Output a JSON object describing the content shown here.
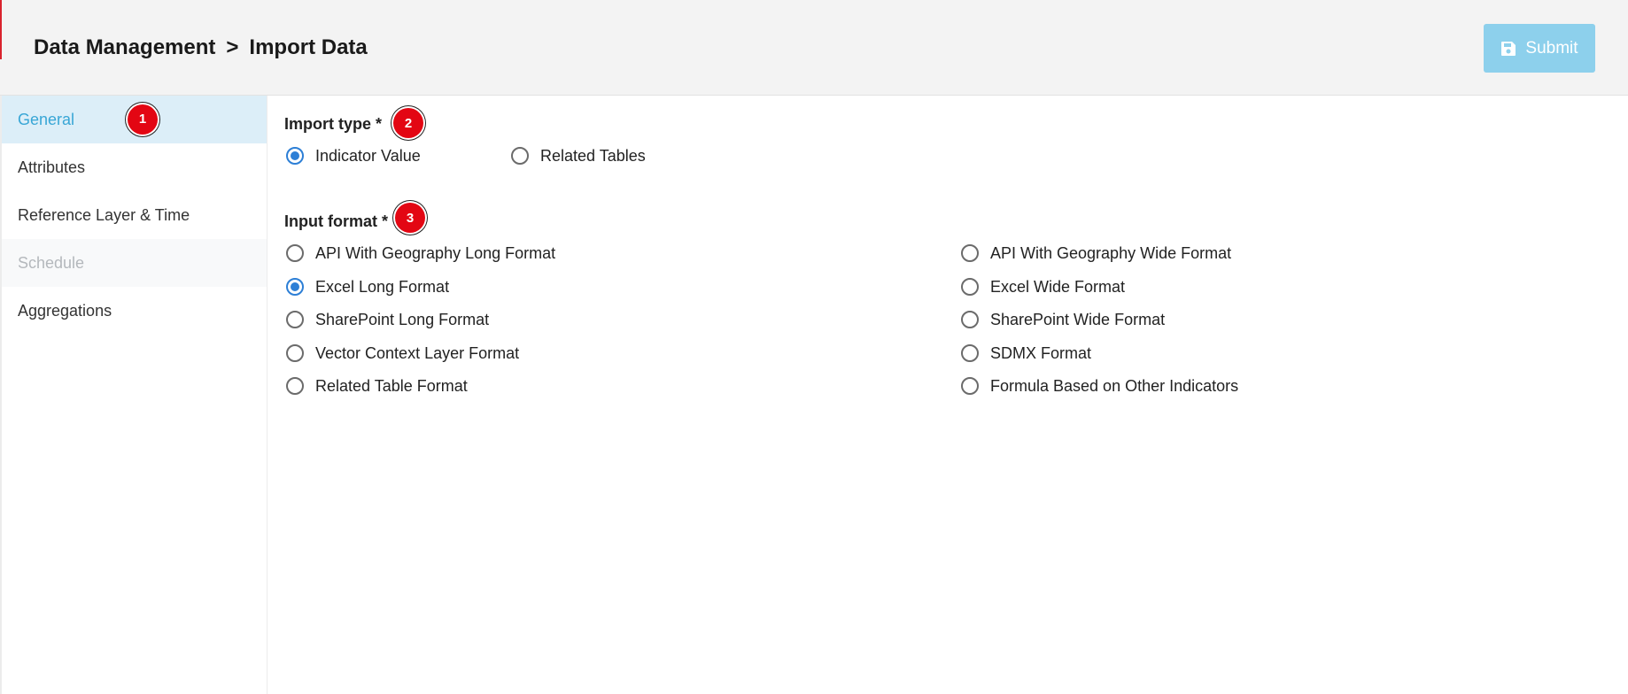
{
  "header": {
    "breadcrumb_parent": "Data Management",
    "breadcrumb_separator": ">",
    "breadcrumb_current": "Import Data",
    "submit_label": "Submit",
    "submit_icon": "save-icon",
    "submit_color": "#8dd0ec"
  },
  "sidebar": {
    "items": [
      {
        "label": "General",
        "state": "active"
      },
      {
        "label": "Attributes",
        "state": "normal"
      },
      {
        "label": "Reference Layer & Time",
        "state": "normal"
      },
      {
        "label": "Schedule",
        "state": "disabled"
      },
      {
        "label": "Aggregations",
        "state": "normal"
      }
    ]
  },
  "badges": [
    "1",
    "2",
    "3"
  ],
  "import_type": {
    "label": "Import type *",
    "options": [
      {
        "label": "Indicator Value",
        "checked": true
      },
      {
        "label": "Related Tables",
        "checked": false
      }
    ]
  },
  "input_format": {
    "label": "Input format *",
    "left_options": [
      {
        "label": "API With Geography Long Format",
        "checked": false
      },
      {
        "label": "Excel Long Format",
        "checked": true
      },
      {
        "label": "SharePoint Long Format",
        "checked": false
      },
      {
        "label": "Vector Context Layer Format",
        "checked": false
      },
      {
        "label": "Related Table Format",
        "checked": false
      }
    ],
    "right_options": [
      {
        "label": "API With Geography Wide Format",
        "checked": false
      },
      {
        "label": "Excel Wide Format",
        "checked": false
      },
      {
        "label": "SharePoint Wide Format",
        "checked": false
      },
      {
        "label": "SDMX Format",
        "checked": false
      },
      {
        "label": "Formula Based on Other Indicators",
        "checked": false
      }
    ]
  },
  "colors": {
    "accent": "#2d7fd6",
    "active_tab_text": "#38a6d6",
    "active_tab_bg": "#dceef8",
    "badge": "#e30613"
  }
}
